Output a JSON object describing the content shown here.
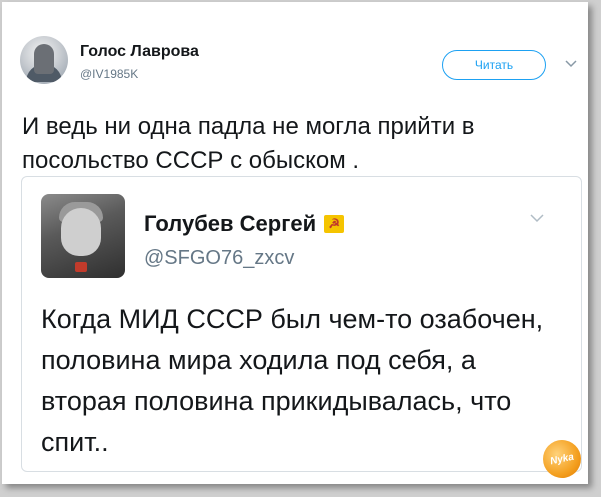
{
  "tweet": {
    "author": {
      "display_name": "Голос Лаврова",
      "handle": "@IV1985K"
    },
    "follow_label": "Читать",
    "text": "И ведь ни одна падла не могла прийти в посольство СССР с обыском .",
    "menu_icon": "chevron-down-icon"
  },
  "quoted_tweet": {
    "author": {
      "display_name": "Голубев Сергей",
      "handle": "@SFGO76_zxcv",
      "flag_icon": "hammer-sickle-flag-icon"
    },
    "text": "Когда МИД СССР был чем-то озабочен, половина мира ходила под себя, а вторая половина прикидывалась, что спит..",
    "menu_icon": "chevron-down-icon"
  },
  "watermark": {
    "text": "Nyka"
  },
  "colors": {
    "accent": "#1da1f2",
    "text": "#14171a",
    "muted": "#657786",
    "border": "#d8dee3"
  }
}
